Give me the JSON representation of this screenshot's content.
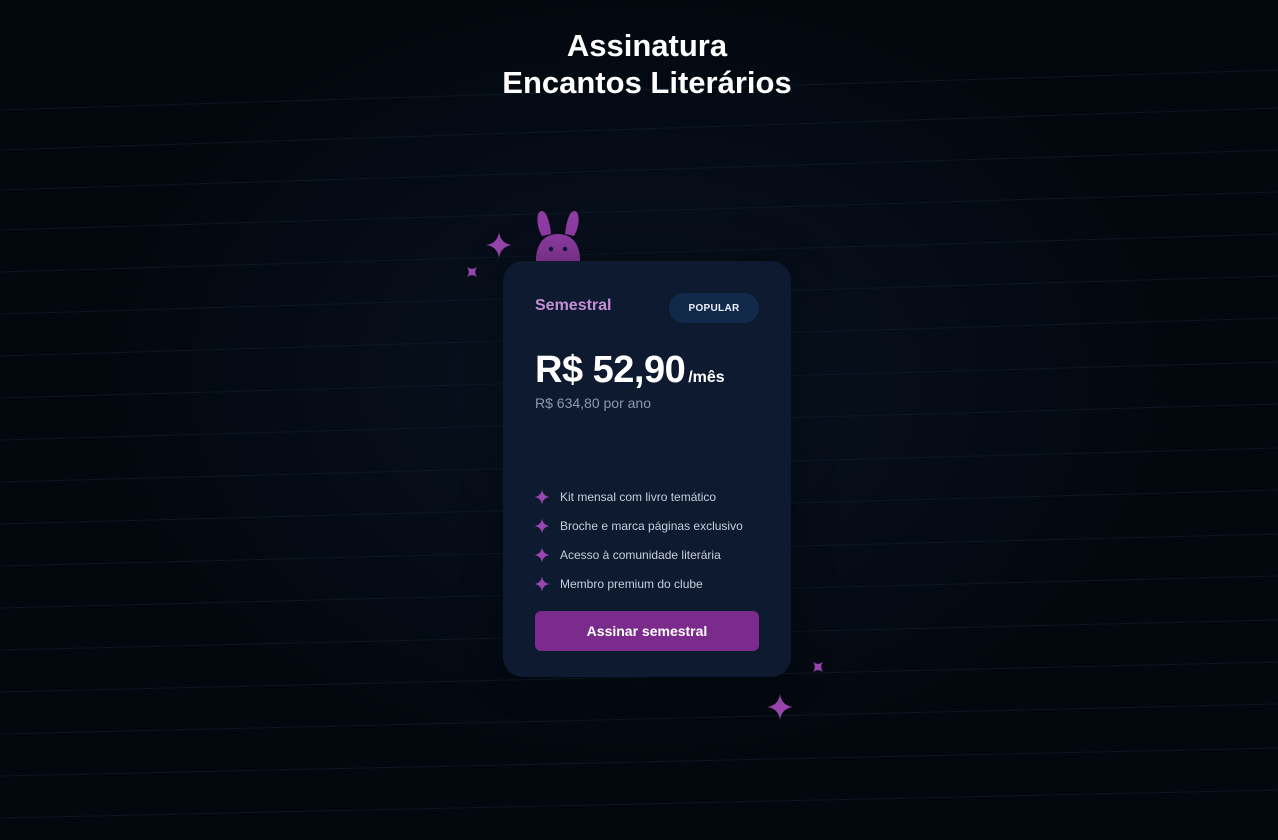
{
  "page": {
    "title_line1": "Assinatura",
    "title_line2": "Encantos Literários"
  },
  "plan": {
    "name": "Semestral",
    "badge": "POPULAR",
    "price": "R$ 52,90",
    "period": "/mês",
    "yearly_total": "R$ 634,80 por ano",
    "features": [
      "Kit mensal com livro temático",
      "Broche e marca páginas exclusivo",
      "Acesso à comunidade literária",
      "Membro premium do clube"
    ],
    "cta_label": "Assinar semestral"
  },
  "icons": {
    "feature_bullet": "sparkle-icon",
    "mascot": "bunny-icon"
  },
  "colors": {
    "background": "#03070e",
    "card": "#0d1a30",
    "accent": "#7b2b8c",
    "plan_name": "#c48fd4",
    "sparkle": "#9b45b0"
  }
}
